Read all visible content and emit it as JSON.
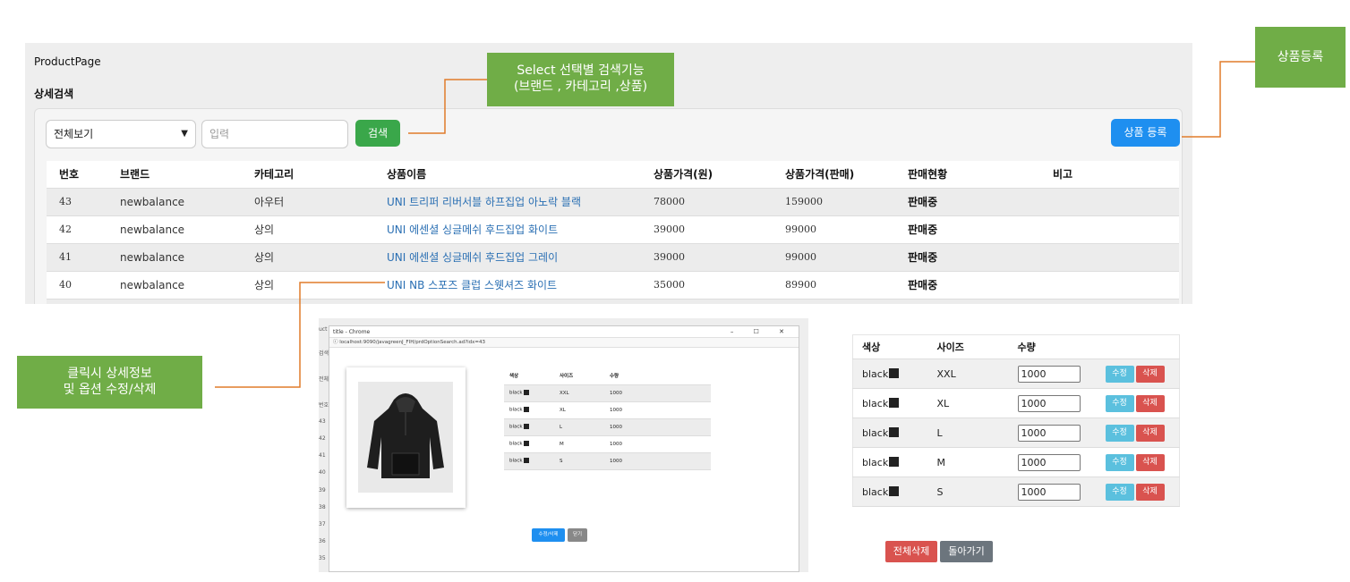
{
  "page": {
    "app_title": "ProductPage",
    "section_title": "상세검색",
    "filter_select": "전체보기",
    "search_placeholder": "입력",
    "search_button": "검색",
    "register_button": "상품 등록",
    "columns": [
      "번호",
      "브랜드",
      "카테고리",
      "상품이름",
      "상품가격(원)",
      "상품가격(판매)",
      "판매현황",
      "비고"
    ],
    "rows": [
      {
        "id": "43",
        "brand": "newbalance",
        "category": "아우터",
        "name": "UNI 트리퍼 리버서블 하프집업 아노락 블랙",
        "price": "78000",
        "sale_price": "159000",
        "status": "판매중"
      },
      {
        "id": "42",
        "brand": "newbalance",
        "category": "상의",
        "name": "UNI 에센셜 싱글메쉬 후드집업 화이트",
        "price": "39000",
        "sale_price": "99000",
        "status": "판매중"
      },
      {
        "id": "41",
        "brand": "newbalance",
        "category": "상의",
        "name": "UNI 에센셜 싱글메쉬 후드집업 그레이",
        "price": "39000",
        "sale_price": "99000",
        "status": "판매중"
      },
      {
        "id": "40",
        "brand": "newbalance",
        "category": "상의",
        "name": "UNI NB 스포즈 클럽 스웻셔즈 화이트",
        "price": "35000",
        "sale_price": "89900",
        "status": "판매중"
      }
    ]
  },
  "callouts": {
    "search_line1": "Select 선택별 검색기능",
    "search_line2": "(브랜드 , 카테고리 ,상품)",
    "register": "상품등록",
    "detail_line1": "클릭시 상세정보",
    "detail_line2": "및 옵션 수정/삭제"
  },
  "popup": {
    "window_title": "title - Chrome",
    "window_controls": "–  ☐  ✕",
    "url": "ⓘ localhost:9090/javagreenJ_FIH/prdOptionSearch.ad?idx=43",
    "bg_labels": [
      "uct",
      "검색",
      "전체",
      "번호",
      "43",
      "42",
      "41",
      "40",
      "39",
      "38",
      "37",
      "36",
      "35"
    ],
    "columns": [
      "색상",
      "사이즈",
      "수량"
    ],
    "rows": [
      {
        "color": "black",
        "size": "XXL",
        "qty": "1000"
      },
      {
        "color": "black",
        "size": "XL",
        "qty": "1000"
      },
      {
        "color": "black",
        "size": "L",
        "qty": "1000"
      },
      {
        "color": "black",
        "size": "M",
        "qty": "1000"
      },
      {
        "color": "black",
        "size": "S",
        "qty": "1000"
      }
    ],
    "edit_button": "수정/삭제",
    "close_button": "닫기"
  },
  "options": {
    "columns": [
      "색상",
      "사이즈",
      "수량"
    ],
    "rows": [
      {
        "color": "black",
        "size": "XXL",
        "qty": "1000"
      },
      {
        "color": "black",
        "size": "XL",
        "qty": "1000"
      },
      {
        "color": "black",
        "size": "L",
        "qty": "1000"
      },
      {
        "color": "black",
        "size": "M",
        "qty": "1000"
      },
      {
        "color": "black",
        "size": "S",
        "qty": "1000"
      }
    ],
    "edit_label": "수정",
    "delete_label": "삭제",
    "delete_all": "전체삭제",
    "back": "돌아가기"
  },
  "colors": {
    "callout_green": "#70ad47",
    "connector_orange": "#e07b2a",
    "primary_blue": "#1e8ff0",
    "search_green": "#3aa74a",
    "danger_red": "#d9534f",
    "info_cyan": "#5bc0de"
  }
}
